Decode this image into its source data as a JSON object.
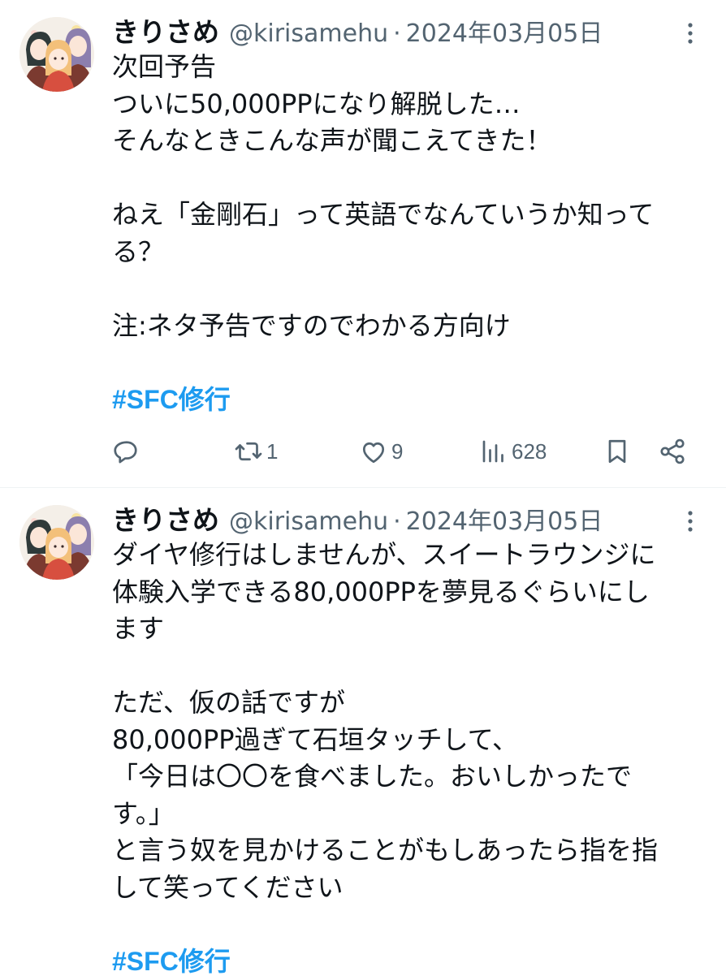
{
  "tweets": [
    {
      "author_name": "きりさめ",
      "author_handle": "@kirisamehu",
      "separator": "·",
      "date": "2024年03月05日",
      "paragraphs": [
        "次回予告\nついに50,000PPになり解脱した…\nそんなときこんな声が聞こえてきた！",
        "ねえ「金剛石」って英語でなんていうか知って\nる？",
        "注:ネタ予告ですのでわかる方向け"
      ],
      "hashtag": "#SFC修行",
      "stats": {
        "replies": "",
        "retweets": "1",
        "likes": "9",
        "views": "628"
      },
      "icons": [
        "reply-icon",
        "retweet-icon",
        "like-icon",
        "views-icon",
        "bookmark-icon",
        "share-icon",
        "more-icon"
      ]
    },
    {
      "author_name": "きりさめ",
      "author_handle": "@kirisamehu",
      "separator": "·",
      "date": "2024年03月05日",
      "paragraphs": [
        "ダイヤ修行はしませんが、スイートラウンジに\n体験入学できる80,000PPを夢見るぐらいにし\nます",
        "ただ、仮の話ですが\n80,000PP過ぎて石垣タッチして、\n「今日は〇〇を食べました。おいしかったで\nす。」\nと言う奴を見かけることがもしあったら指を指\nして笑ってください"
      ],
      "hashtag": "#SFC修行"
    }
  ],
  "colors": {
    "text": "#0f1419",
    "secondary": "#536471",
    "accent": "#1d9bf0",
    "divider": "#eff3f4"
  }
}
